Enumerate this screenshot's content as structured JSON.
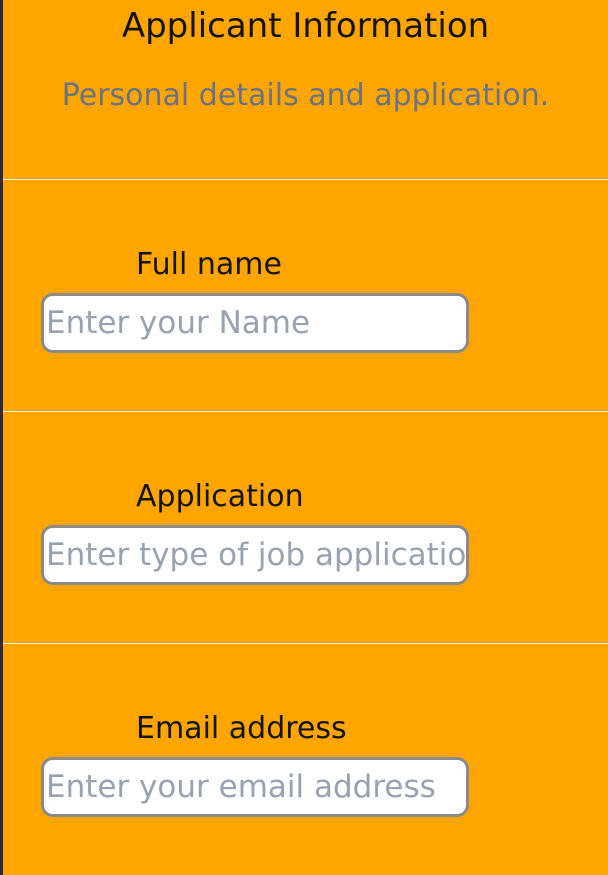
{
  "header": {
    "title": "Applicant Information",
    "subtitle": "Personal details and application."
  },
  "fields": [
    {
      "label": "Full name",
      "placeholder": "Enter your Name",
      "value": ""
    },
    {
      "label": "Application",
      "placeholder": "Enter type of job application",
      "value": ""
    },
    {
      "label": "Email address",
      "placeholder": "Enter your email address",
      "value": ""
    }
  ],
  "colors": {
    "background": "#ffa500",
    "title": "#141414",
    "subtitle": "#6b7280",
    "input_border": "#8a8a8a",
    "placeholder": "#9aa2ae",
    "left_edge": "#2b2b2b"
  }
}
